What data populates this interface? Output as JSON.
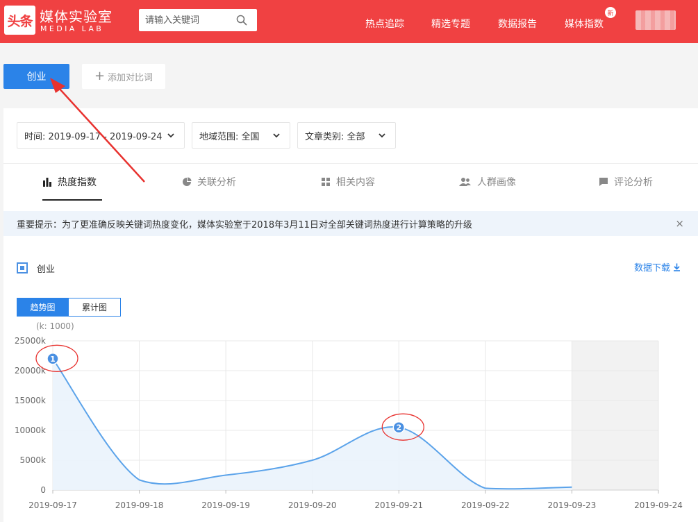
{
  "header": {
    "logo_mark": "头条",
    "logo_title": "媒体实验室",
    "logo_sub": "MEDIA LAB",
    "search_placeholder": "请输入关键词",
    "nav": [
      {
        "label": "热点追踪"
      },
      {
        "label": "精选专题"
      },
      {
        "label": "数据报告"
      },
      {
        "label": "媒体指数"
      }
    ],
    "new_badge": "新"
  },
  "keyword": {
    "active": "创业",
    "add_label": "添加对比词"
  },
  "filters": [
    {
      "label": "时间: 2019-09-17 - 2019-09-24"
    },
    {
      "label": "地域范围: 全国"
    },
    {
      "label": "文章类别: 全部"
    }
  ],
  "tabs": [
    {
      "label": "热度指数",
      "icon": "bar-chart-icon",
      "active": true
    },
    {
      "label": "关联分析",
      "icon": "pie-chart-icon",
      "active": false
    },
    {
      "label": "相关内容",
      "icon": "grid-icon",
      "active": false
    },
    {
      "label": "人群画像",
      "icon": "users-icon",
      "active": false
    },
    {
      "label": "评论分析",
      "icon": "comment-icon",
      "active": false
    }
  ],
  "notice": {
    "text": "重要提示：为了更准确反映关键词热度变化，媒体实验室于2018年3月11日对全部关键词热度进行计算策略的升级",
    "close": "×"
  },
  "legend": {
    "label": "创业"
  },
  "download_label": "数据下载",
  "view_toggle": {
    "trend": "趋势图",
    "cumulative": "累计图"
  },
  "unit_label": "(k: 1000)",
  "colors": {
    "brand_red": "#f04142",
    "accent_blue": "#2b83e8",
    "line_blue": "#5ba3ea",
    "area_fill": "#eaf3fc",
    "annotation_red": "#e8322f"
  },
  "chart_data": {
    "type": "area",
    "categories": [
      "2019-09-17",
      "2019-09-18",
      "2019-09-19",
      "2019-09-20",
      "2019-09-21",
      "2019-09-22",
      "2019-09-23",
      "2019-09-24"
    ],
    "values": [
      22000,
      1700,
      2500,
      5000,
      10500,
      300,
      500,
      null
    ],
    "ylim": [
      0,
      25000
    ],
    "yticks": [
      "0",
      "5000k",
      "10000k",
      "15000k",
      "20000k",
      "25000k"
    ],
    "grid": true,
    "shaded_tail_from": "2019-09-23",
    "markers": [
      {
        "label": "1",
        "index": 0
      },
      {
        "label": "2",
        "index": 4
      }
    ]
  }
}
